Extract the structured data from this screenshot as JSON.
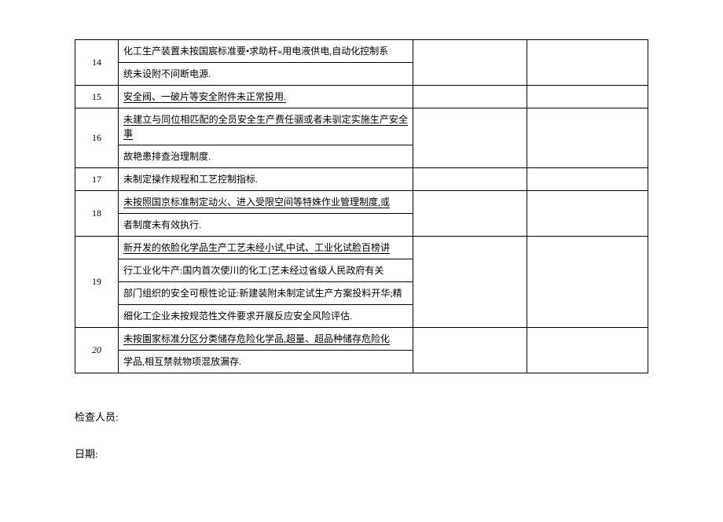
{
  "table": {
    "rows": [
      {
        "num": "14",
        "lines": [
          "化工生产装置未按国宸标准要•求助杆«用电液供电,自动化控制系",
          "统未设附不间断电源."
        ],
        "underline": [
          false,
          false
        ]
      },
      {
        "num": "15",
        "lines": [
          "安全阀、一破片等安全附件未正常投用."
        ],
        "underline": [
          true
        ]
      },
      {
        "num": "16",
        "lines": [
          "未建立与同位相匹配的全员安全生产费任骃或者未驯定实施生产安全事",
          "故艳患排查治理制度."
        ],
        "underline": [
          true,
          false
        ]
      },
      {
        "num": "17",
        "lines": [
          "未制定操作规程和工艺控制指标."
        ],
        "underline": [
          false
        ]
      },
      {
        "num": "18",
        "lines": [
          "未按照国京标准制定动火、进入受限空间等特姝作业管理制度,或",
          "者制度未有效执行."
        ],
        "underline": [
          true,
          false
        ]
      },
      {
        "num": "19",
        "lines": [
          "新开发的依脸化学品生产工艺未经小试,中试、工业化试脸百榜讲",
          "行工业化牛产:国内首次使川的化工]艺未经过省级人民政府有关",
          "部门组织的安全可根性论证:新建装附未制定试生产方案投料开华;精",
          "细化工企业未按规范性文件要求开展反应安全风险评估."
        ],
        "underline": [
          true,
          false,
          false,
          false
        ]
      },
      {
        "num": "20",
        "italicNum": true,
        "lines": [
          "未按園家标准分区分类储存危险化学品,超量、超品种储存危险化",
          "学品,相互禁就物项混放漏存."
        ],
        "underline": [
          true,
          false
        ]
      }
    ]
  },
  "footer": {
    "inspector_label": "检查人员:",
    "date_label": "日期:"
  }
}
